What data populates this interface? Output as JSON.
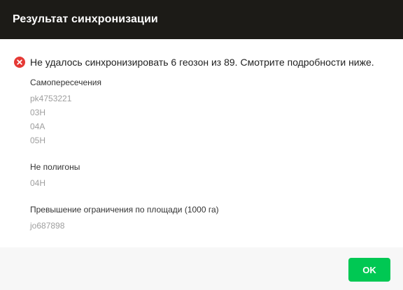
{
  "dialog": {
    "title": "Результат синхронизации",
    "error_message": "Не удалось синхронизировать 6 геозон из 89. Смотрите подробности ниже.",
    "error_icon": "error-circle-icon",
    "error_color": "#e53935",
    "groups": [
      {
        "title": "Самопересечения",
        "items": [
          "pk4753221",
          "03H",
          "04A",
          "05H"
        ]
      },
      {
        "title": "Не полигоны",
        "items": [
          "04H"
        ]
      },
      {
        "title": "Превышение ограничения по площади (1000 га)",
        "items": [
          "jo687898"
        ]
      }
    ],
    "ok_label": "OK",
    "accent_color": "#00c853"
  }
}
